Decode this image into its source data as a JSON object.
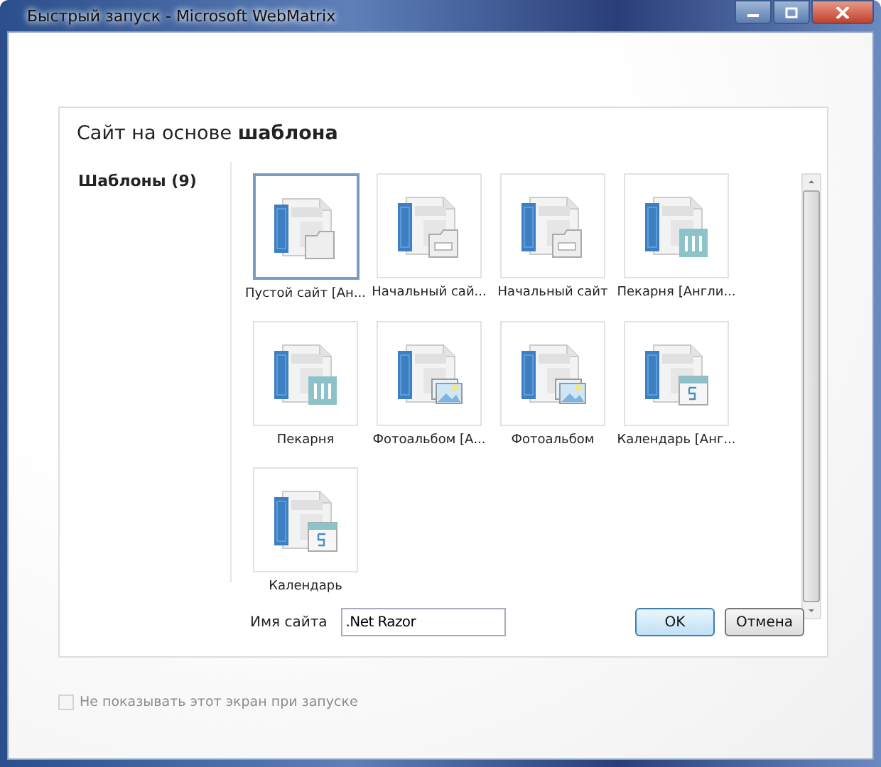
{
  "window": {
    "title": "Быстрый запуск - Microsoft WebMatrix"
  },
  "dialog": {
    "heading": "Сайт на основе **шаблона**",
    "sidebar": {
      "items": [
        {
          "label": "Шаблоны (9)",
          "selected": true
        }
      ]
    },
    "templates": [
      {
        "label": "Пустой сайт [Ан...",
        "kind": "folder",
        "selected": true
      },
      {
        "label": "Начальный сай...",
        "kind": "window",
        "selected": false
      },
      {
        "label": "Начальный сайт",
        "kind": "window",
        "selected": false
      },
      {
        "label": "Пекарня [Англи...",
        "kind": "bakery",
        "selected": false
      },
      {
        "label": "Пекарня",
        "kind": "bakery",
        "selected": false
      },
      {
        "label": "Фотоальбом [А...",
        "kind": "photo",
        "selected": false
      },
      {
        "label": "Фотоальбом",
        "kind": "photo",
        "selected": false
      },
      {
        "label": "Календарь [Анг...",
        "kind": "calendar",
        "selected": false
      },
      {
        "label": "Календарь",
        "kind": "calendar",
        "selected": false
      }
    ],
    "site_name": {
      "label": "Имя сайта",
      "value": ".Net Razor"
    },
    "buttons": [
      "OK",
      "Отмена"
    ]
  },
  "startup_checkbox": {
    "label": "Не показывать этот экран при запуске",
    "checked": false,
    "disabled": true
  }
}
